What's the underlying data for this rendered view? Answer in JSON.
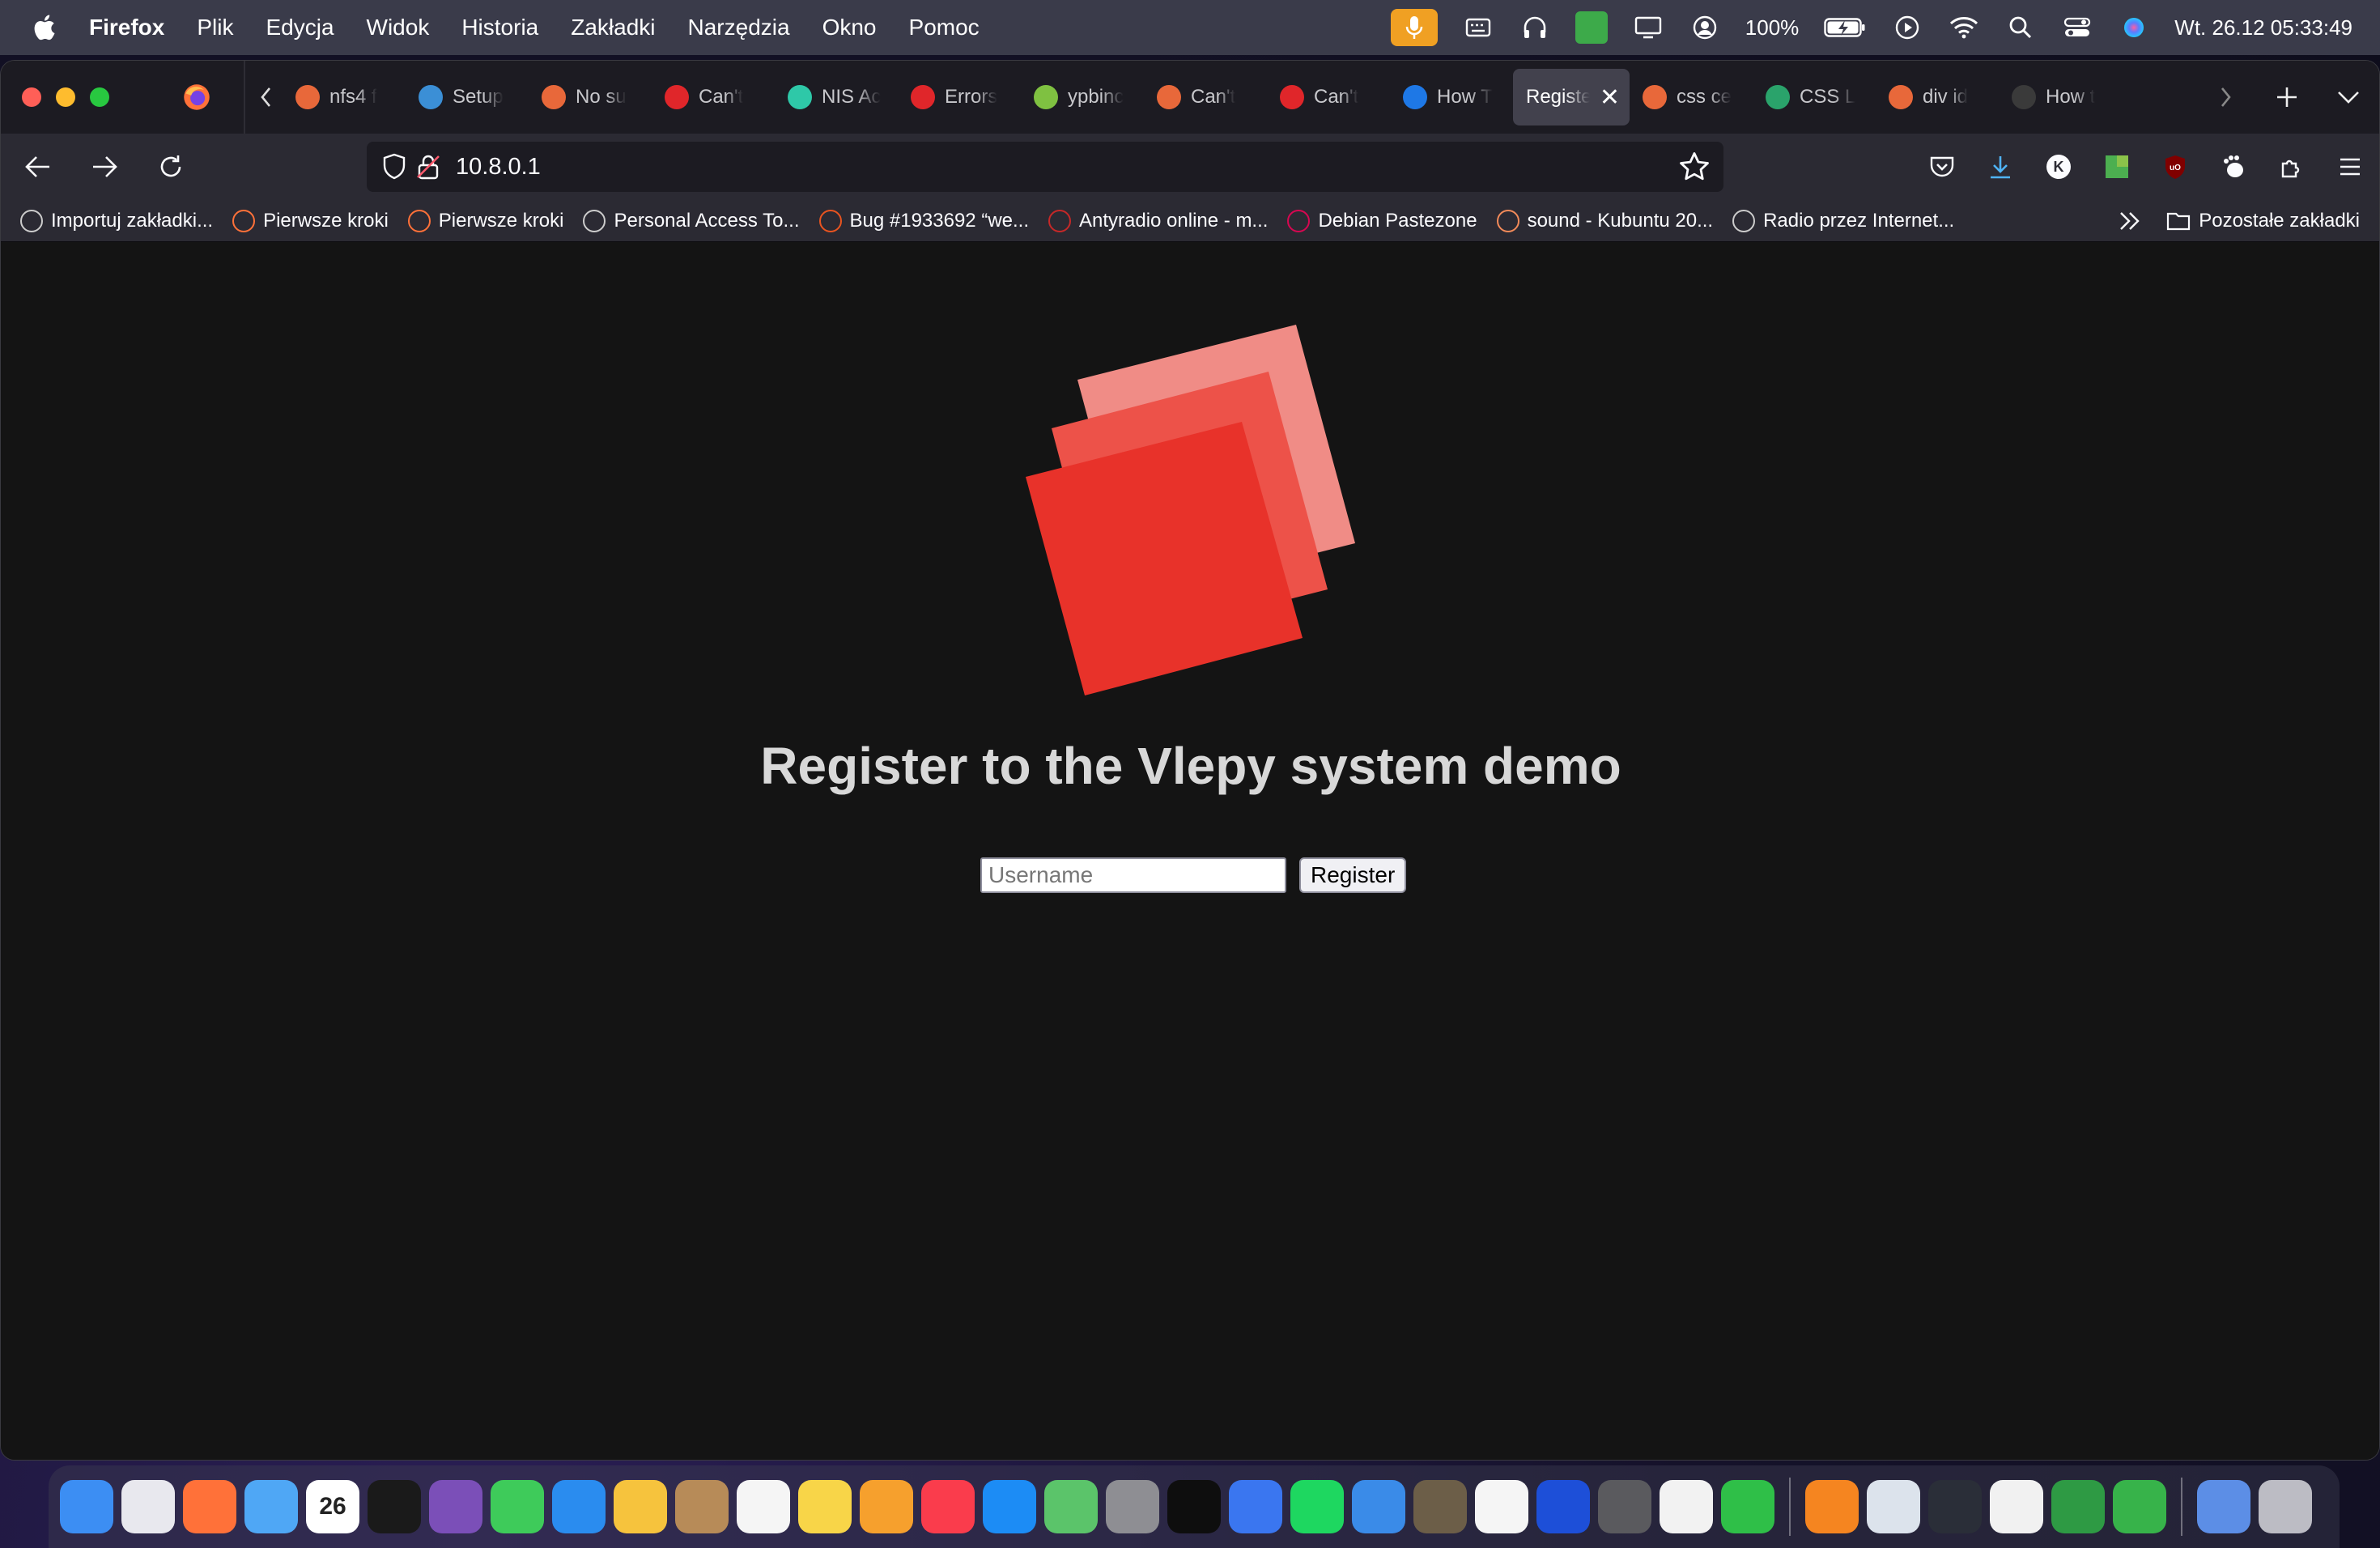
{
  "menubar": {
    "app_name": "Firefox",
    "menu": [
      "Plik",
      "Edycja",
      "Widok",
      "Historia",
      "Zakładki",
      "Narzędzia",
      "Okno",
      "Pomoc"
    ],
    "battery": "100%",
    "datetime": "Wt. 26.12  05:33:49"
  },
  "tabs": [
    {
      "label": "nfs4 f",
      "color": "#e8683a"
    },
    {
      "label": "Setup",
      "color": "#3b8fd6"
    },
    {
      "label": "No su",
      "color": "#e8683a"
    },
    {
      "label": "Can't",
      "color": "#e0262a"
    },
    {
      "label": "NIS Ac",
      "color": "#2ec8a8"
    },
    {
      "label": "Errors",
      "color": "#e0262a"
    },
    {
      "label": "ypbinc",
      "color": "#7fc141"
    },
    {
      "label": "Can't",
      "color": "#e8683a"
    },
    {
      "label": "Can't",
      "color": "#e0262a"
    },
    {
      "label": "How T",
      "color": "#1e78e6"
    },
    {
      "label": "Registe",
      "color": "",
      "active": true
    },
    {
      "label": "css ce",
      "color": "#e8683a"
    },
    {
      "label": "CSS L",
      "color": "#2aa36b"
    },
    {
      "label": "div id",
      "color": "#e8683a"
    },
    {
      "label": "How t",
      "color": "#3a3a3a"
    }
  ],
  "url": "10.8.0.1",
  "bookmarks": [
    {
      "label": "Importuj zakładki...",
      "color": "#cccccc"
    },
    {
      "label": "Pierwsze kroki",
      "color": "#ff7139"
    },
    {
      "label": "Pierwsze kroki",
      "color": "#ff7139"
    },
    {
      "label": "Personal Access To...",
      "color": "#cccccc"
    },
    {
      "label": "Bug #1933692 “we...",
      "color": "#e95420"
    },
    {
      "label": "Antyradio online - m...",
      "color": "#c62828"
    },
    {
      "label": "Debian Pastezone",
      "color": "#d70751"
    },
    {
      "label": "sound - Kubuntu 20...",
      "color": "#f28a59"
    },
    {
      "label": "Radio przez Internet...",
      "color": "#cccccc"
    }
  ],
  "bookmarks_other": "Pozostałe zakładki",
  "page": {
    "heading": "Register to the Vlepy system demo",
    "username_placeholder": "Username",
    "register_label": "Register"
  },
  "colors": {
    "logo_front": "#e8322a",
    "logo_middle": "#ed5249",
    "logo_back": "#f08c86"
  },
  "dock": [
    {
      "name": "finder",
      "color": "#3c8ef3"
    },
    {
      "name": "launchpad",
      "color": "#e8e8ee"
    },
    {
      "name": "firefox",
      "color": "#ff7139"
    },
    {
      "name": "mail",
      "color": "#4fa7f5"
    },
    {
      "name": "calendar",
      "color": "#ffffff",
      "text": "26"
    },
    {
      "name": "terminal",
      "color": "#1a1a1a"
    },
    {
      "name": "tor",
      "color": "#7b4fb8"
    },
    {
      "name": "messages",
      "color": "#3ecb5a"
    },
    {
      "name": "safari",
      "color": "#2a8cef"
    },
    {
      "name": "photos",
      "color": "#f6c33d"
    },
    {
      "name": "contacts",
      "color": "#b78b58"
    },
    {
      "name": "reminders",
      "color": "#f5f5f5"
    },
    {
      "name": "notes",
      "color": "#f8d548"
    },
    {
      "name": "pages",
      "color": "#f6a02d"
    },
    {
      "name": "music",
      "color": "#fa3c4c"
    },
    {
      "name": "app-store",
      "color": "#1c8cf5"
    },
    {
      "name": "maps",
      "color": "#5bc46a"
    },
    {
      "name": "system-settings",
      "color": "#8e8e93"
    },
    {
      "name": "activity-monitor",
      "color": "#0e0e0e"
    },
    {
      "name": "signal",
      "color": "#3a76f0"
    },
    {
      "name": "spotify",
      "color": "#1ed760"
    },
    {
      "name": "weather",
      "color": "#3a8be8"
    },
    {
      "name": "gimp",
      "color": "#6c5e48"
    },
    {
      "name": "inkscape",
      "color": "#f5f5f5"
    },
    {
      "name": "vpn",
      "color": "#1d4fd8"
    },
    {
      "name": "calculator",
      "color": "#5a5a5e"
    },
    {
      "name": "ble",
      "color": "#f2f2f2"
    },
    {
      "name": "numbers",
      "color": "#2fbf48"
    },
    {
      "name": "vlc",
      "color": "#f58520"
    },
    {
      "name": "preview",
      "color": "#dce3ec"
    },
    {
      "name": "quicktime",
      "color": "#2a2e38"
    },
    {
      "name": "textedit",
      "color": "#f1f1f1"
    },
    {
      "name": "vim",
      "color": "#2e9a44"
    },
    {
      "name": "sourcetree",
      "color": "#37b34a"
    },
    {
      "name": "downloads",
      "color": "#5c8ee6"
    },
    {
      "name": "trash",
      "color": "#bcbcc4"
    }
  ]
}
